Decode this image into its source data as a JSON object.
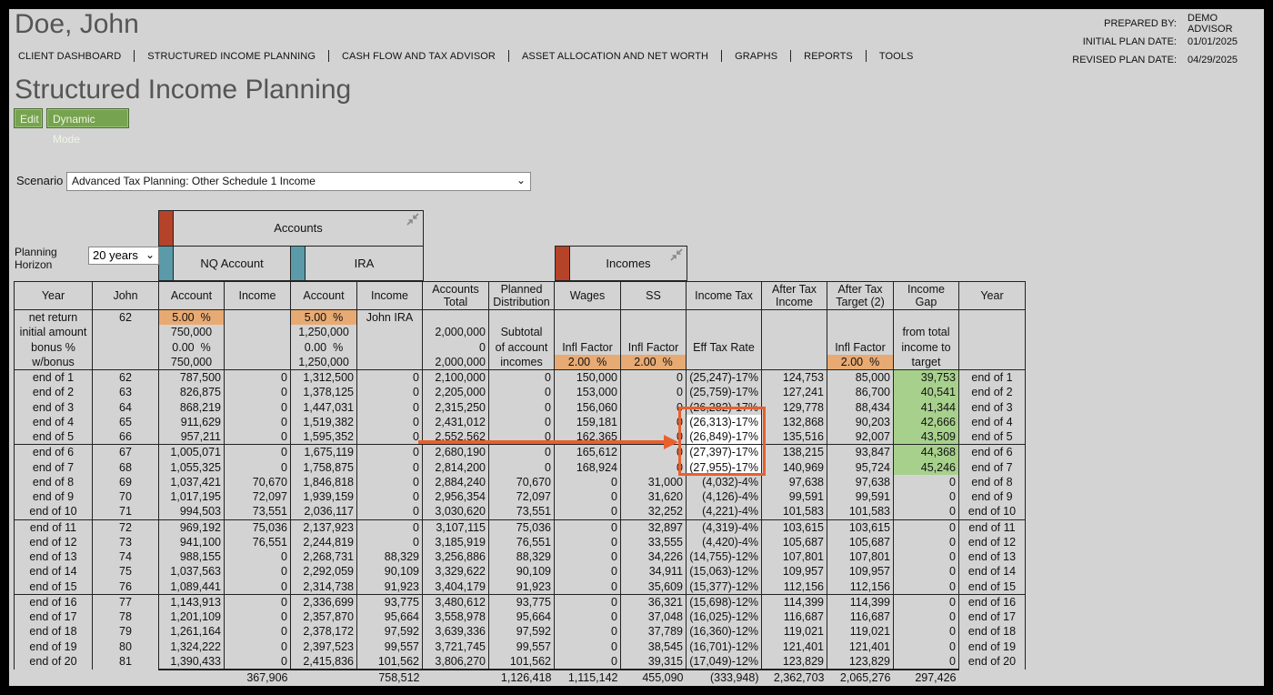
{
  "client_name": "Doe, John",
  "nav": [
    "CLIENT DASHBOARD",
    "STRUCTURED INCOME PLANNING",
    "CASH FLOW AND TAX ADVISOR",
    "ASSET ALLOCATION AND NET WORTH",
    "GRAPHS",
    "REPORTS",
    "TOOLS"
  ],
  "plan_info": {
    "prepared_by_label": "PREPARED BY:",
    "prepared_by": "DEMO ADVISOR",
    "initial_label": "INITIAL PLAN DATE:",
    "initial": "01/01/2025",
    "revised_label": "REVISED PLAN DATE:",
    "revised": "04/29/2025"
  },
  "page_title": "Structured Income Planning",
  "buttons": {
    "edit": "Edit",
    "dynamic": "Dynamic Mode"
  },
  "scenario": {
    "label": "Scenario",
    "value": "Advanced Tax Planning: Other Schedule 1 Income"
  },
  "horizon": {
    "label": "Planning Horizon",
    "value": "20 years"
  },
  "groups": {
    "accounts": "Accounts",
    "nq": "NQ Account",
    "ira": "IRA",
    "incomes": "Incomes"
  },
  "colors": {
    "red_tab": "#b5432a",
    "blue_tab": "#5b9aa8",
    "orange": "#e8aa73",
    "green": "#a8d08d",
    "accent_arrow": "#e8602e"
  },
  "columns": [
    "Year",
    "John",
    "Account",
    "Income",
    "Account",
    "Income",
    "Accounts Total",
    "Planned Distribution",
    "Wages",
    "SS",
    "Income Tax",
    "After Tax Income",
    "After Tax Target (2)",
    "Income Gap",
    "Year"
  ],
  "params": {
    "labels": [
      "net return",
      "initial amount",
      "bonus %",
      "w/bonus"
    ],
    "john_age": "62",
    "nq_return": "5.00",
    "nq_initial": "750,000",
    "nq_bonus": "0.00",
    "nq_wbonus": "750,000",
    "ira_return": "5.00",
    "ira_initial": "1,250,000",
    "ira_bonus": "0.00",
    "ira_wbonus": "1,250,000",
    "ira_income_label": "John IRA",
    "total_initial": "2,000,000",
    "total_bonus": "0",
    "total_wbonus": "2,000,000",
    "planned_lines": [
      "Subtotal",
      "of account",
      "incomes"
    ],
    "infl_factor": "Infl Factor",
    "wages_infl": "2.00",
    "ss_infl": "2.00",
    "target_infl": "2.00",
    "pct": "%",
    "eff_tax": "Eff Tax Rate",
    "gap_lines": [
      "from total",
      "income to",
      "target"
    ]
  },
  "rows": [
    [
      "end of 1",
      "62",
      "787,500",
      "0",
      "1,312,500",
      "0",
      "2,100,000",
      "0",
      "150,000",
      "0",
      "(25,247)-17%",
      "124,753",
      "85,000",
      "39,753",
      "end of 1"
    ],
    [
      "end of 2",
      "63",
      "826,875",
      "0",
      "1,378,125",
      "0",
      "2,205,000",
      "0",
      "153,000",
      "0",
      "(25,759)-17%",
      "127,241",
      "86,700",
      "40,541",
      "end of 2"
    ],
    [
      "end of 3",
      "64",
      "868,219",
      "0",
      "1,447,031",
      "0",
      "2,315,250",
      "0",
      "156,060",
      "0",
      "(26,282)-17%",
      "129,778",
      "88,434",
      "41,344",
      "end of 3"
    ],
    [
      "end of 4",
      "65",
      "911,629",
      "0",
      "1,519,382",
      "0",
      "2,431,012",
      "0",
      "159,181",
      "0",
      "(26,313)-17%",
      "132,868",
      "90,203",
      "42,666",
      "end of 4"
    ],
    [
      "end of 5",
      "66",
      "957,211",
      "0",
      "1,595,352",
      "0",
      "2,552,562",
      "0",
      "162,365",
      "0",
      "(26,849)-17%",
      "135,516",
      "92,007",
      "43,509",
      "end of 5"
    ],
    [
      "end of 6",
      "67",
      "1,005,071",
      "0",
      "1,675,119",
      "0",
      "2,680,190",
      "0",
      "165,612",
      "0",
      "(27,397)-17%",
      "138,215",
      "93,847",
      "44,368",
      "end of 6"
    ],
    [
      "end of 7",
      "68",
      "1,055,325",
      "0",
      "1,758,875",
      "0",
      "2,814,200",
      "0",
      "168,924",
      "0",
      "(27,955)-17%",
      "140,969",
      "95,724",
      "45,246",
      "end of 7"
    ],
    [
      "end of 8",
      "69",
      "1,037,421",
      "70,670",
      "1,846,818",
      "0",
      "2,884,240",
      "70,670",
      "0",
      "31,000",
      "(4,032)-4%",
      "97,638",
      "97,638",
      "0",
      "end of 8"
    ],
    [
      "end of 9",
      "70",
      "1,017,195",
      "72,097",
      "1,939,159",
      "0",
      "2,956,354",
      "72,097",
      "0",
      "31,620",
      "(4,126)-4%",
      "99,591",
      "99,591",
      "0",
      "end of 9"
    ],
    [
      "end of 10",
      "71",
      "994,503",
      "73,551",
      "2,036,117",
      "0",
      "3,030,620",
      "73,551",
      "0",
      "32,252",
      "(4,221)-4%",
      "101,583",
      "101,583",
      "0",
      "end of 10"
    ],
    [
      "end of 11",
      "72",
      "969,192",
      "75,036",
      "2,137,923",
      "0",
      "3,107,115",
      "75,036",
      "0",
      "32,897",
      "(4,319)-4%",
      "103,615",
      "103,615",
      "0",
      "end of 11"
    ],
    [
      "end of 12",
      "73",
      "941,100",
      "76,551",
      "2,244,819",
      "0",
      "3,185,919",
      "76,551",
      "0",
      "33,555",
      "(4,420)-4%",
      "105,687",
      "105,687",
      "0",
      "end of 12"
    ],
    [
      "end of 13",
      "74",
      "988,155",
      "0",
      "2,268,731",
      "88,329",
      "3,256,886",
      "88,329",
      "0",
      "34,226",
      "(14,755)-12%",
      "107,801",
      "107,801",
      "0",
      "end of 13"
    ],
    [
      "end of 14",
      "75",
      "1,037,563",
      "0",
      "2,292,059",
      "90,109",
      "3,329,622",
      "90,109",
      "0",
      "34,911",
      "(15,063)-12%",
      "109,957",
      "109,957",
      "0",
      "end of 14"
    ],
    [
      "end of 15",
      "76",
      "1,089,441",
      "0",
      "2,314,738",
      "91,923",
      "3,404,179",
      "91,923",
      "0",
      "35,609",
      "(15,377)-12%",
      "112,156",
      "112,156",
      "0",
      "end of 15"
    ],
    [
      "end of 16",
      "77",
      "1,143,913",
      "0",
      "2,336,699",
      "93,775",
      "3,480,612",
      "93,775",
      "0",
      "36,321",
      "(15,698)-12%",
      "114,399",
      "114,399",
      "0",
      "end of 16"
    ],
    [
      "end of 17",
      "78",
      "1,201,109",
      "0",
      "2,357,870",
      "95,664",
      "3,558,978",
      "95,664",
      "0",
      "37,048",
      "(16,025)-12%",
      "116,687",
      "116,687",
      "0",
      "end of 17"
    ],
    [
      "end of 18",
      "79",
      "1,261,164",
      "0",
      "2,378,172",
      "97,592",
      "3,639,336",
      "97,592",
      "0",
      "37,789",
      "(16,360)-12%",
      "119,021",
      "119,021",
      "0",
      "end of 18"
    ],
    [
      "end of 19",
      "80",
      "1,324,222",
      "0",
      "2,397,523",
      "99,557",
      "3,721,745",
      "99,557",
      "0",
      "38,545",
      "(16,701)-12%",
      "121,401",
      "121,401",
      "0",
      "end of 19"
    ],
    [
      "end of 20",
      "81",
      "1,390,433",
      "0",
      "2,415,836",
      "101,562",
      "3,806,270",
      "101,562",
      "0",
      "39,315",
      "(17,049)-12%",
      "123,829",
      "123,829",
      "0",
      "end of 20"
    ]
  ],
  "totals": [
    "",
    "",
    "",
    "367,906",
    "",
    "758,512",
    "",
    "1,126,418",
    "1,115,142",
    "455,090",
    "(333,948)",
    "2,362,703",
    "2,065,276",
    "297,426",
    ""
  ]
}
